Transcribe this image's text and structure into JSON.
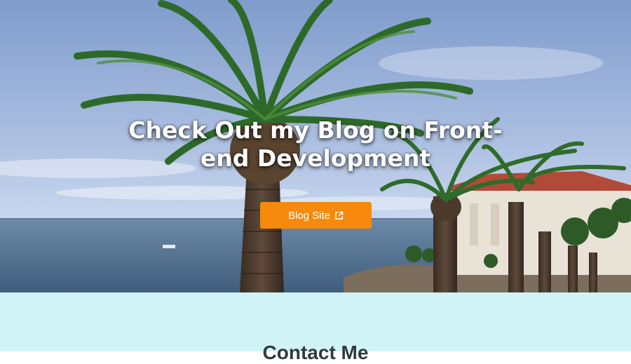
{
  "hero": {
    "headline": "Check Out my Blog on Front-end Development",
    "cta_label": "Blog Site",
    "cta_icon": "external-link-icon",
    "background": "palm-trees-ocean-photo"
  },
  "contact": {
    "title": "Contact Me"
  },
  "colors": {
    "accent": "#f78a0c",
    "contact_bg": "#cff3f6",
    "heading": "#2f3b3e"
  }
}
